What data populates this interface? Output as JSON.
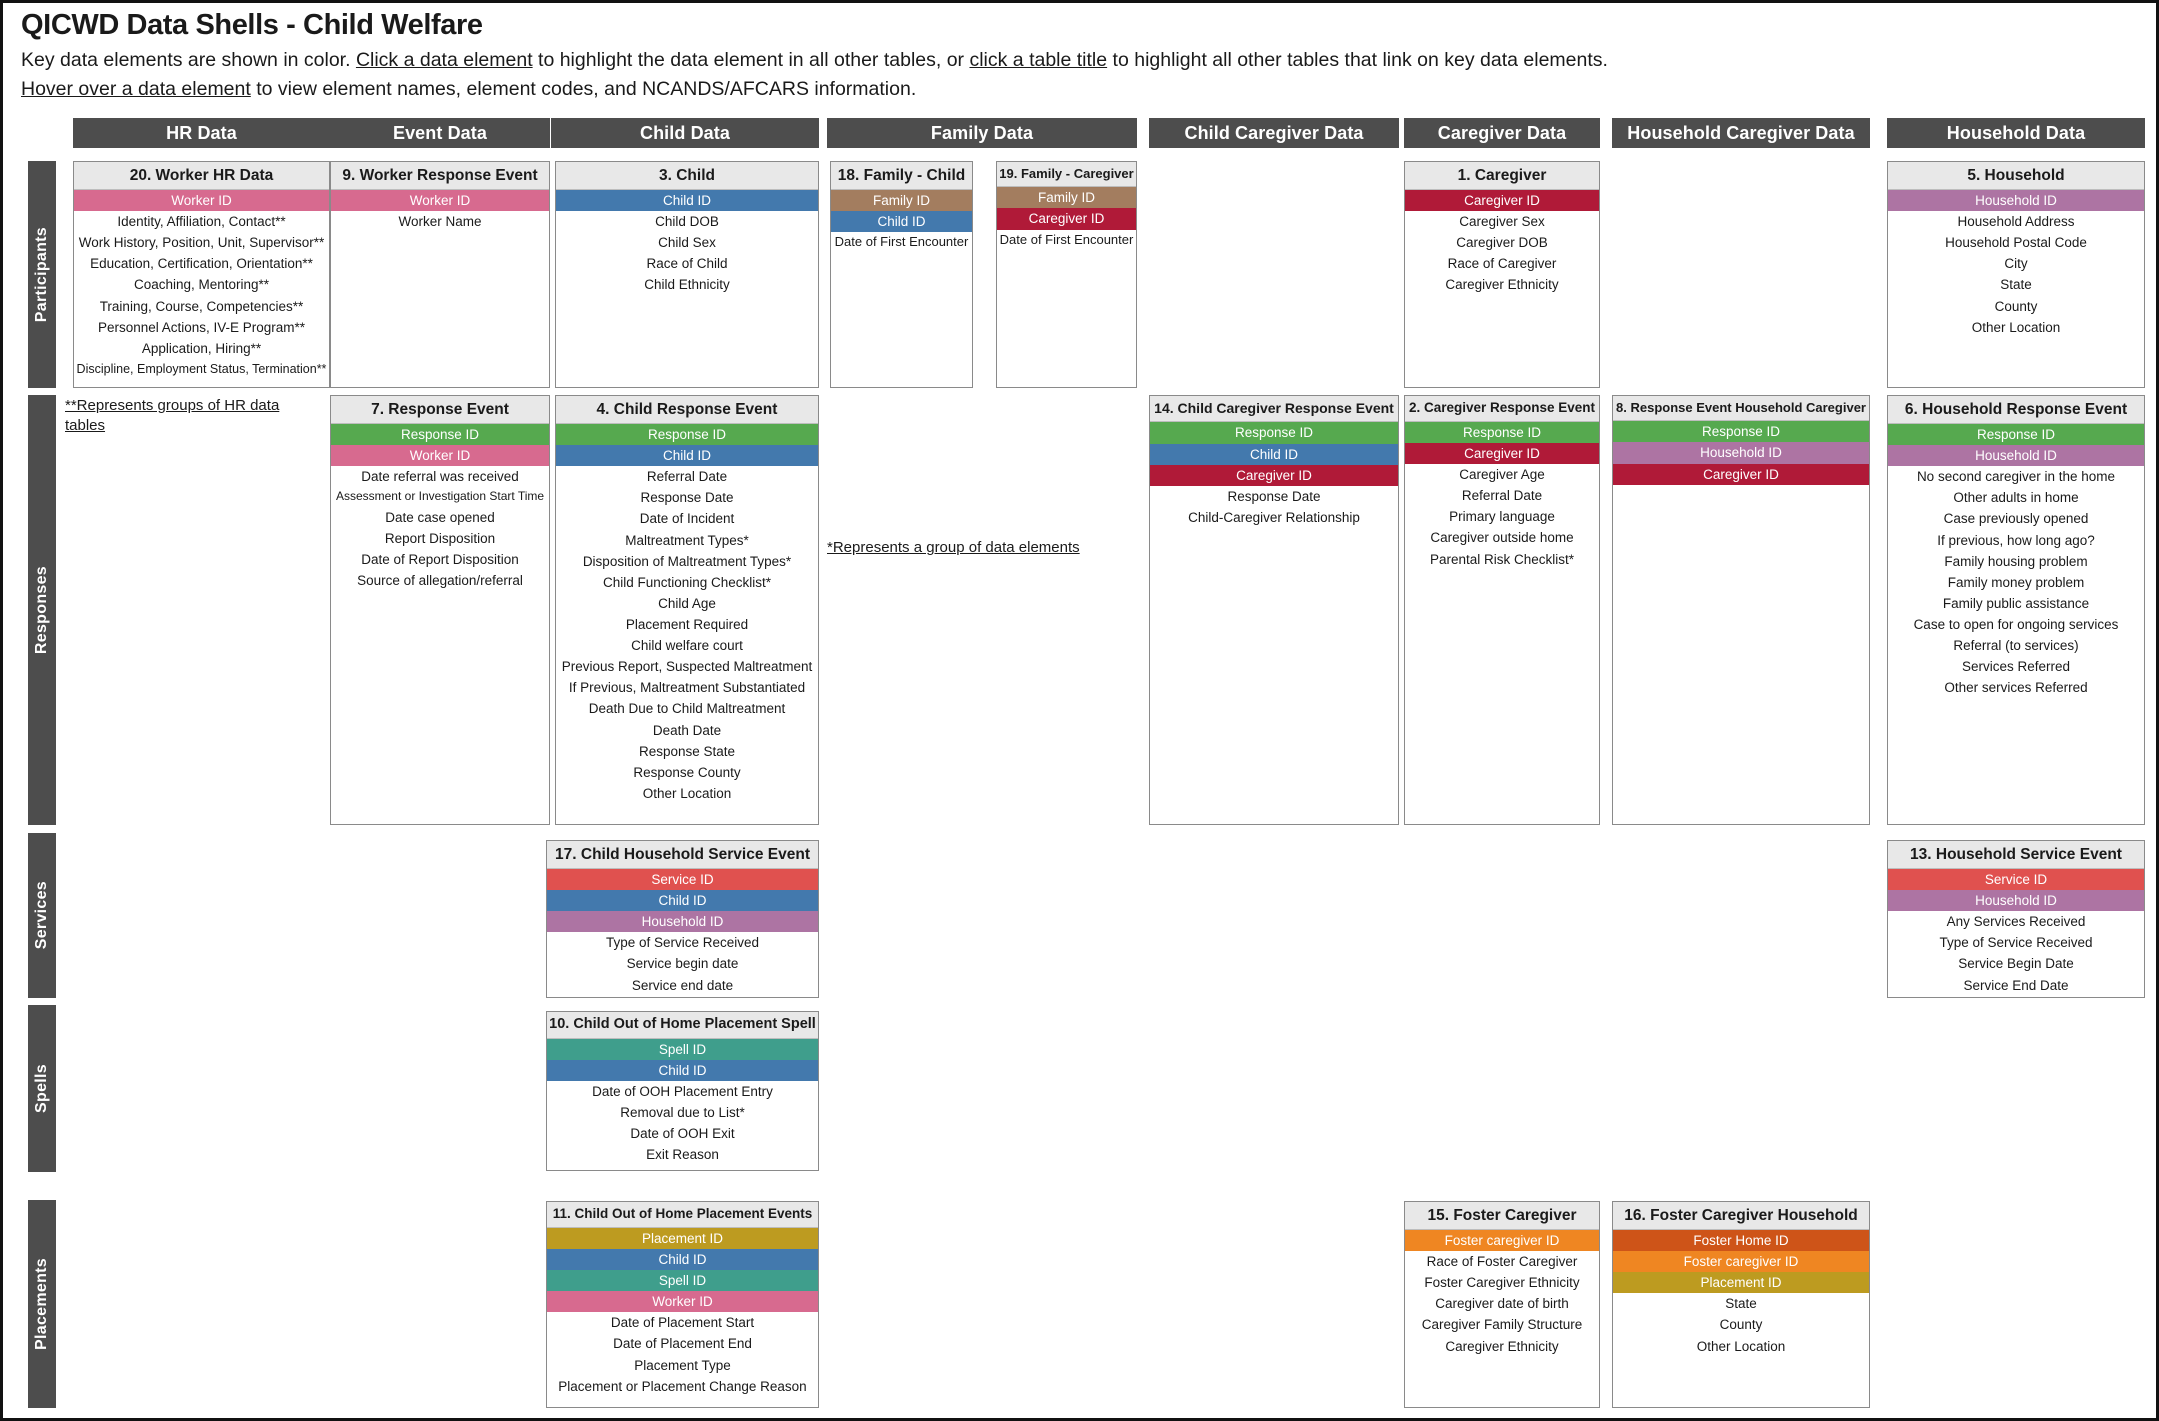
{
  "header": {
    "title": "QICWD Data Shells - Child Welfare",
    "line1_a": "Key data elements are shown in color. ",
    "line1_link1": "Click a data element",
    "line1_b": " to highlight the data element in all other tables, or ",
    "line1_link2": "click a table title",
    "line1_c": " to highlight all other tables that link on key data elements.",
    "line2_link": "Hover over a data element",
    "line2_rest": " to view element names, element codes, and NCANDS/AFCARS information."
  },
  "columns": [
    {
      "label": "HR Data"
    },
    {
      "label": "Event Data"
    },
    {
      "label": "Child Data"
    },
    {
      "label": "Family Data"
    },
    {
      "label": "Child Caregiver Data"
    },
    {
      "label": "Caregiver Data"
    },
    {
      "label": "Household Caregiver Data"
    },
    {
      "label": "Household Data"
    }
  ],
  "row_labels": [
    {
      "label": "Participants"
    },
    {
      "label": "Responses"
    },
    {
      "label": "Services"
    },
    {
      "label": "Spells"
    },
    {
      "label": "Placements"
    }
  ],
  "notes": {
    "hr_note": "**Represents groups of HR data tables",
    "group_note": "*Represents a group of data elements"
  },
  "key_colors": {
    "worker_id": "#d76a8f",
    "child_id": "#4379ad",
    "family_id": "#a37d5f",
    "caregiver_id": "#b01a38",
    "household_id": "#ad74a3",
    "response_id": "#56a94f",
    "service_id": "#e0514f",
    "spell_id": "#3f9e8c",
    "placement_id": "#bd9b20",
    "foster_caregiver_id": "#ef8622",
    "foster_home_id": "#ce5418",
    "header_gray": "#4d4d4d",
    "title_gray": "#e8e8e8"
  },
  "tables": [
    {
      "id": "t20",
      "title": "20. Worker HR Data",
      "rows": [
        {
          "label": "Worker ID",
          "key": "worker_id"
        },
        {
          "label": "Identity, Affiliation, Contact**"
        },
        {
          "label": "Work History, Position, Unit, Supervisor**"
        },
        {
          "label": "Education, Certification, Orientation**"
        },
        {
          "label": "Coaching, Mentoring**"
        },
        {
          "label": "Training, Course, Competencies**"
        },
        {
          "label": "Personnel Actions, IV-E Program**"
        },
        {
          "label": "Application, Hiring**"
        },
        {
          "label": "Discipline, Employment Status, Termination**"
        }
      ]
    },
    {
      "id": "t9",
      "title": "9. Worker Response Event",
      "rows": [
        {
          "label": "Worker ID",
          "key": "worker_id"
        },
        {
          "label": "Worker Name"
        }
      ]
    },
    {
      "id": "t3",
      "title": "3. Child",
      "rows": [
        {
          "label": "Child ID",
          "key": "child_id"
        },
        {
          "label": "Child DOB"
        },
        {
          "label": "Child Sex"
        },
        {
          "label": "Race of Child"
        },
        {
          "label": "Child Ethnicity"
        }
      ]
    },
    {
      "id": "t18",
      "title": "18. Family - Child",
      "rows": [
        {
          "label": "Family ID",
          "key": "family_id"
        },
        {
          "label": "Child ID",
          "key": "child_id"
        },
        {
          "label": "Date of First Encounter"
        }
      ]
    },
    {
      "id": "t19",
      "title": "19. Family - Caregiver",
      "rows": [
        {
          "label": "Family ID",
          "key": "family_id"
        },
        {
          "label": "Caregiver ID",
          "key": "caregiver_id"
        },
        {
          "label": "Date of First Encounter"
        }
      ]
    },
    {
      "id": "t1",
      "title": "1. Caregiver",
      "rows": [
        {
          "label": "Caregiver ID",
          "key": "caregiver_id"
        },
        {
          "label": "Caregiver Sex"
        },
        {
          "label": "Caregiver DOB"
        },
        {
          "label": "Race of Caregiver"
        },
        {
          "label": "Caregiver Ethnicity"
        }
      ]
    },
    {
      "id": "t5",
      "title": "5. Household",
      "rows": [
        {
          "label": "Household ID",
          "key": "household_id"
        },
        {
          "label": "Household Address"
        },
        {
          "label": "Household Postal Code"
        },
        {
          "label": "City"
        },
        {
          "label": "State"
        },
        {
          "label": "County"
        },
        {
          "label": "Other Location"
        }
      ]
    },
    {
      "id": "t7",
      "title": "7. Response Event",
      "rows": [
        {
          "label": "Response ID",
          "key": "response_id"
        },
        {
          "label": "Worker ID",
          "key": "worker_id"
        },
        {
          "label": "Date referral was received"
        },
        {
          "label": "Assessment or Investigation Start Time"
        },
        {
          "label": "Date case opened"
        },
        {
          "label": "Report Disposition"
        },
        {
          "label": "Date of Report Disposition"
        },
        {
          "label": "Source of allegation/referral"
        }
      ]
    },
    {
      "id": "t4",
      "title": "4. Child Response Event",
      "rows": [
        {
          "label": "Response ID",
          "key": "response_id"
        },
        {
          "label": "Child ID",
          "key": "child_id"
        },
        {
          "label": "Referral Date"
        },
        {
          "label": "Response Date"
        },
        {
          "label": "Date of Incident"
        },
        {
          "label": "Maltreatment Types*"
        },
        {
          "label": "Disposition of Maltreatment Types*"
        },
        {
          "label": "Child Functioning Checklist*"
        },
        {
          "label": "Child Age"
        },
        {
          "label": "Placement Required"
        },
        {
          "label": "Child welfare court"
        },
        {
          "label": "Previous Report, Suspected Maltreatment"
        },
        {
          "label": "If Previous, Maltreatment Substantiated"
        },
        {
          "label": "Death Due to Child Maltreatment"
        },
        {
          "label": "Death Date"
        },
        {
          "label": "Response State"
        },
        {
          "label": "Response County"
        },
        {
          "label": "Other Location"
        }
      ]
    },
    {
      "id": "t14",
      "title": "14. Child Caregiver Response Event",
      "rows": [
        {
          "label": "Response ID",
          "key": "response_id"
        },
        {
          "label": "Child ID",
          "key": "child_id"
        },
        {
          "label": "Caregiver ID",
          "key": "caregiver_id"
        },
        {
          "label": "Response Date"
        },
        {
          "label": "Child-Caregiver Relationship"
        }
      ]
    },
    {
      "id": "t2",
      "title": "2. Caregiver Response Event",
      "rows": [
        {
          "label": "Response ID",
          "key": "response_id"
        },
        {
          "label": "Caregiver ID",
          "key": "caregiver_id"
        },
        {
          "label": "Caregiver Age"
        },
        {
          "label": "Referral Date"
        },
        {
          "label": "Primary language"
        },
        {
          "label": "Caregiver outside home"
        },
        {
          "label": "Parental Risk Checklist*"
        }
      ]
    },
    {
      "id": "t8",
      "title": "8. Response Event Household Caregiver",
      "rows": [
        {
          "label": "Response ID",
          "key": "response_id"
        },
        {
          "label": "Household ID",
          "key": "household_id"
        },
        {
          "label": "Caregiver ID",
          "key": "caregiver_id"
        }
      ]
    },
    {
      "id": "t6",
      "title": "6. Household Response Event",
      "rows": [
        {
          "label": "Response ID",
          "key": "response_id"
        },
        {
          "label": "Household ID",
          "key": "household_id"
        },
        {
          "label": "No second caregiver in the home"
        },
        {
          "label": "Other adults in home"
        },
        {
          "label": "Case previously opened"
        },
        {
          "label": "If previous, how long ago?"
        },
        {
          "label": "Family housing problem"
        },
        {
          "label": "Family money problem"
        },
        {
          "label": "Family public assistance"
        },
        {
          "label": "Case to open for ongoing services"
        },
        {
          "label": "Referral (to services)"
        },
        {
          "label": "Services Referred"
        },
        {
          "label": "Other services Referred"
        }
      ]
    },
    {
      "id": "t17",
      "title": "17. Child Household Service Event",
      "rows": [
        {
          "label": "Service ID",
          "key": "service_id"
        },
        {
          "label": "Child ID",
          "key": "child_id"
        },
        {
          "label": "Household ID",
          "key": "household_id"
        },
        {
          "label": "Type of Service Received"
        },
        {
          "label": "Service begin date"
        },
        {
          "label": "Service end date"
        }
      ]
    },
    {
      "id": "t13",
      "title": "13. Household Service Event",
      "rows": [
        {
          "label": "Service ID",
          "key": "service_id"
        },
        {
          "label": "Household ID",
          "key": "household_id"
        },
        {
          "label": "Any Services Received"
        },
        {
          "label": "Type of Service Received"
        },
        {
          "label": "Service Begin Date"
        },
        {
          "label": "Service End Date"
        }
      ]
    },
    {
      "id": "t10",
      "title": "10. Child Out of Home Placement Spell",
      "rows": [
        {
          "label": "Spell ID",
          "key": "spell_id"
        },
        {
          "label": "Child ID",
          "key": "child_id"
        },
        {
          "label": "Date of OOH Placement Entry"
        },
        {
          "label": "Removal due to List*"
        },
        {
          "label": "Date of OOH Exit"
        },
        {
          "label": "Exit Reason"
        }
      ]
    },
    {
      "id": "t11",
      "title": "11. Child Out of Home Placement Events",
      "rows": [
        {
          "label": "Placement ID",
          "key": "placement_id"
        },
        {
          "label": "Child ID",
          "key": "child_id"
        },
        {
          "label": "Spell ID",
          "key": "spell_id"
        },
        {
          "label": "Worker ID",
          "key": "worker_id"
        },
        {
          "label": "Date of Placement Start"
        },
        {
          "label": "Date of Placement End"
        },
        {
          "label": "Placement Type"
        },
        {
          "label": "Placement or Placement Change Reason"
        }
      ]
    },
    {
      "id": "t15",
      "title": "15. Foster Caregiver",
      "rows": [
        {
          "label": "Foster caregiver ID",
          "key": "foster_caregiver_id"
        },
        {
          "label": "Race of Foster Caregiver"
        },
        {
          "label": "Foster Caregiver Ethnicity"
        },
        {
          "label": "Caregiver date of birth"
        },
        {
          "label": "Caregiver Family Structure"
        },
        {
          "label": "Caregiver Ethnicity"
        }
      ]
    },
    {
      "id": "t16",
      "title": "16. Foster Caregiver Household",
      "rows": [
        {
          "label": "Foster Home ID",
          "key": "foster_home_id"
        },
        {
          "label": "Foster caregiver ID",
          "key": "foster_caregiver_id"
        },
        {
          "label": "Placement ID",
          "key": "placement_id"
        },
        {
          "label": "State"
        },
        {
          "label": "County"
        },
        {
          "label": "Other Location"
        }
      ]
    }
  ]
}
